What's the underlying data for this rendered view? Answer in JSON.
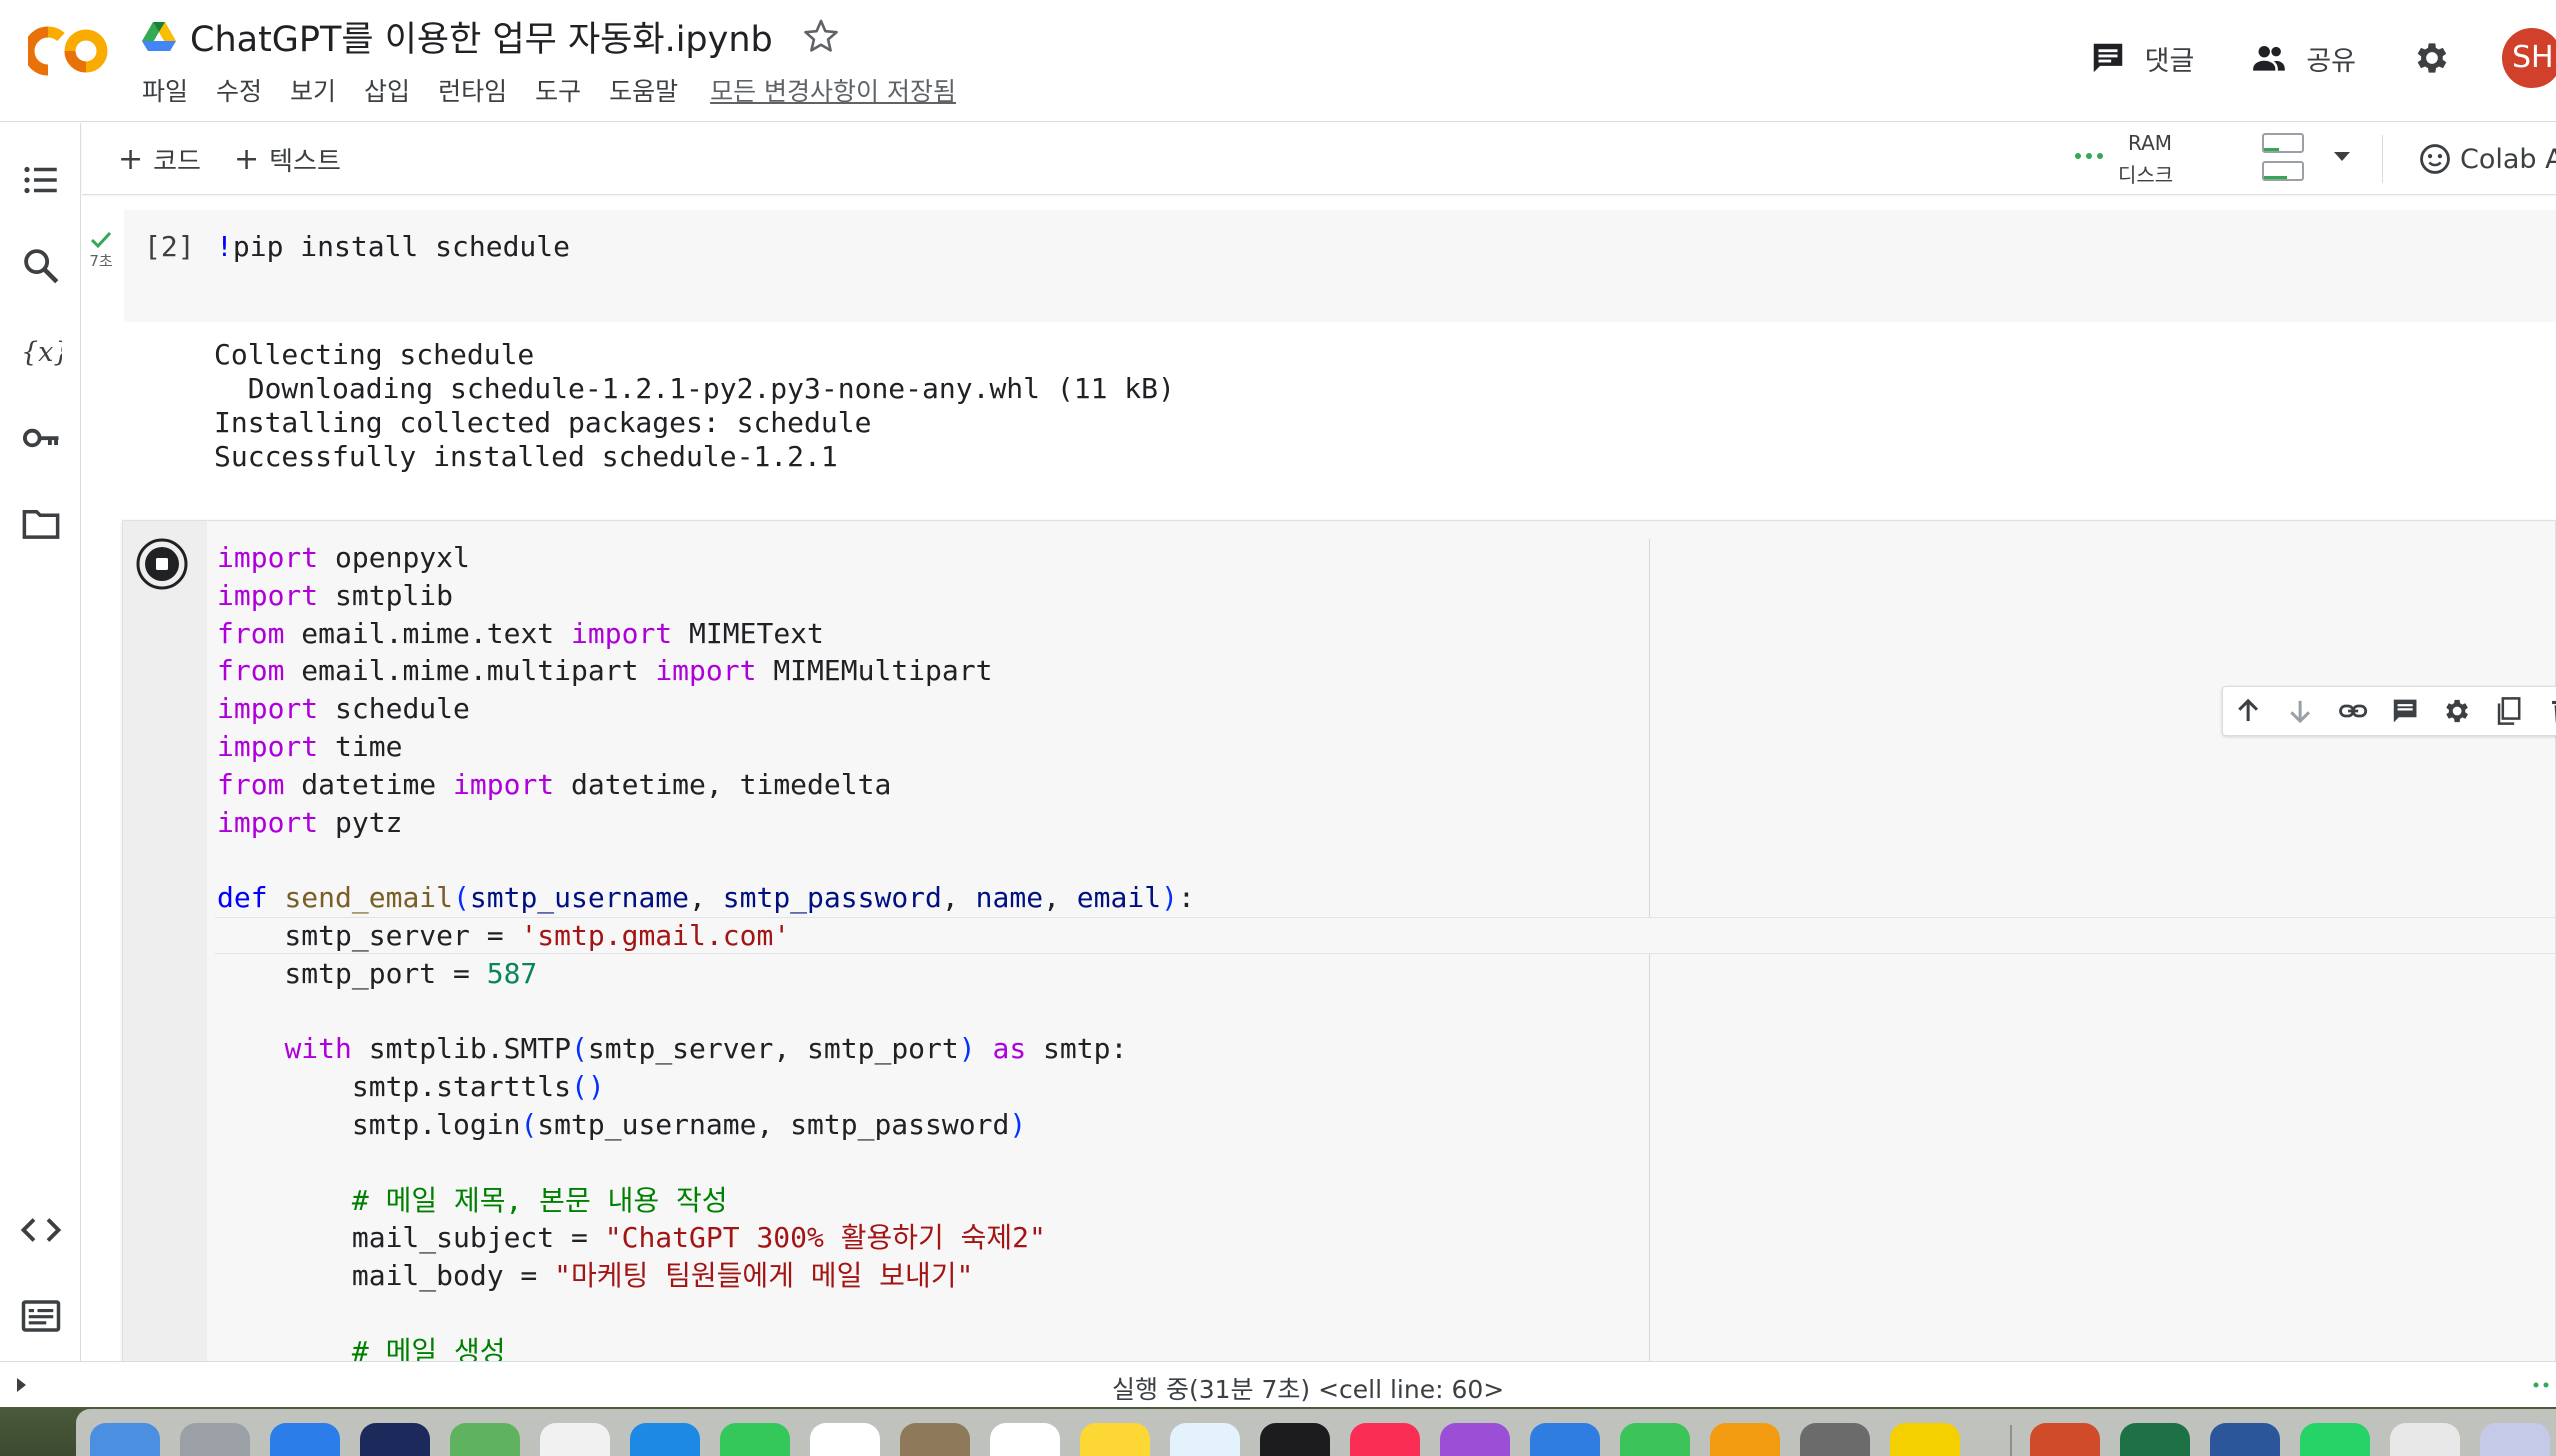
{
  "app": {
    "title": "ChatGPT를 이용한 업무 자동화.ipynb",
    "menu": [
      "파일",
      "수정",
      "보기",
      "삽입",
      "런타임",
      "도구",
      "도움말"
    ],
    "saved_status": "모든 변경사항이 저장됨",
    "comment_label": "댓글",
    "share_label": "공유",
    "avatar_initials": "SH"
  },
  "toolbar": {
    "add_code_label": "코드",
    "add_text_label": "텍스트",
    "ram_label": "RAM",
    "disk_label": "디스크",
    "colab_ai_label": "Colab AI"
  },
  "cells": {
    "cell1": {
      "exec_count": "[2]",
      "exec_time": "7초",
      "code_bang": "!",
      "code_rest": "pip install schedule",
      "output": [
        "Collecting schedule",
        "  Downloading schedule-1.2.1-py2.py3-none-any.whl (11 kB)",
        "Installing collected packages: schedule",
        "Successfully installed schedule-1.2.1"
      ]
    },
    "cell2": {
      "code_lines": [
        "import openpyxl",
        "import smtplib",
        "from email.mime.text import MIMEText",
        "from email.mime.multipart import MIMEMultipart",
        "import schedule",
        "import time",
        "from datetime import datetime, timedelta",
        "import pytz",
        "",
        "def send_email(smtp_username, smtp_password, name, email):",
        "    smtp_server = 'smtp.gmail.com'",
        "    smtp_port = 587",
        "",
        "    with smtplib.SMTP(smtp_server, smtp_port) as smtp:",
        "        smtp.starttls()",
        "        smtp.login(smtp_username, smtp_password)",
        "",
        "        # 메일 제목, 본문 내용 작성",
        "        mail_subject = \"ChatGPT 300% 활용하기 숙제2\"",
        "        mail_body = \"마케팅 팀원들에게 메일 보내기\"",
        "",
        "        # 메일 생성"
      ]
    }
  },
  "statusbar": {
    "text": "실행 중(31분 7초)  <cell line: 60>"
  },
  "colors": {
    "keyword": "#af00db",
    "def": "#0000ff",
    "function": "#795e26",
    "param": "#001080",
    "string": "#a31515",
    "number": "#098658",
    "comment": "#008000",
    "avatar": "#d0402b",
    "colab_orange": "#f9ab00"
  },
  "icons": {
    "rail": [
      "table-of-contents-icon",
      "search-icon",
      "variables-icon",
      "secrets-key-icon",
      "files-folder-icon",
      "code-snippets-icon",
      "terminal-icon"
    ],
    "cell_toolbar": [
      "move-up-icon",
      "move-down-icon",
      "link-icon",
      "comment-icon",
      "settings-icon",
      "mirror-cell-icon",
      "delete-icon",
      "more-icon"
    ]
  }
}
